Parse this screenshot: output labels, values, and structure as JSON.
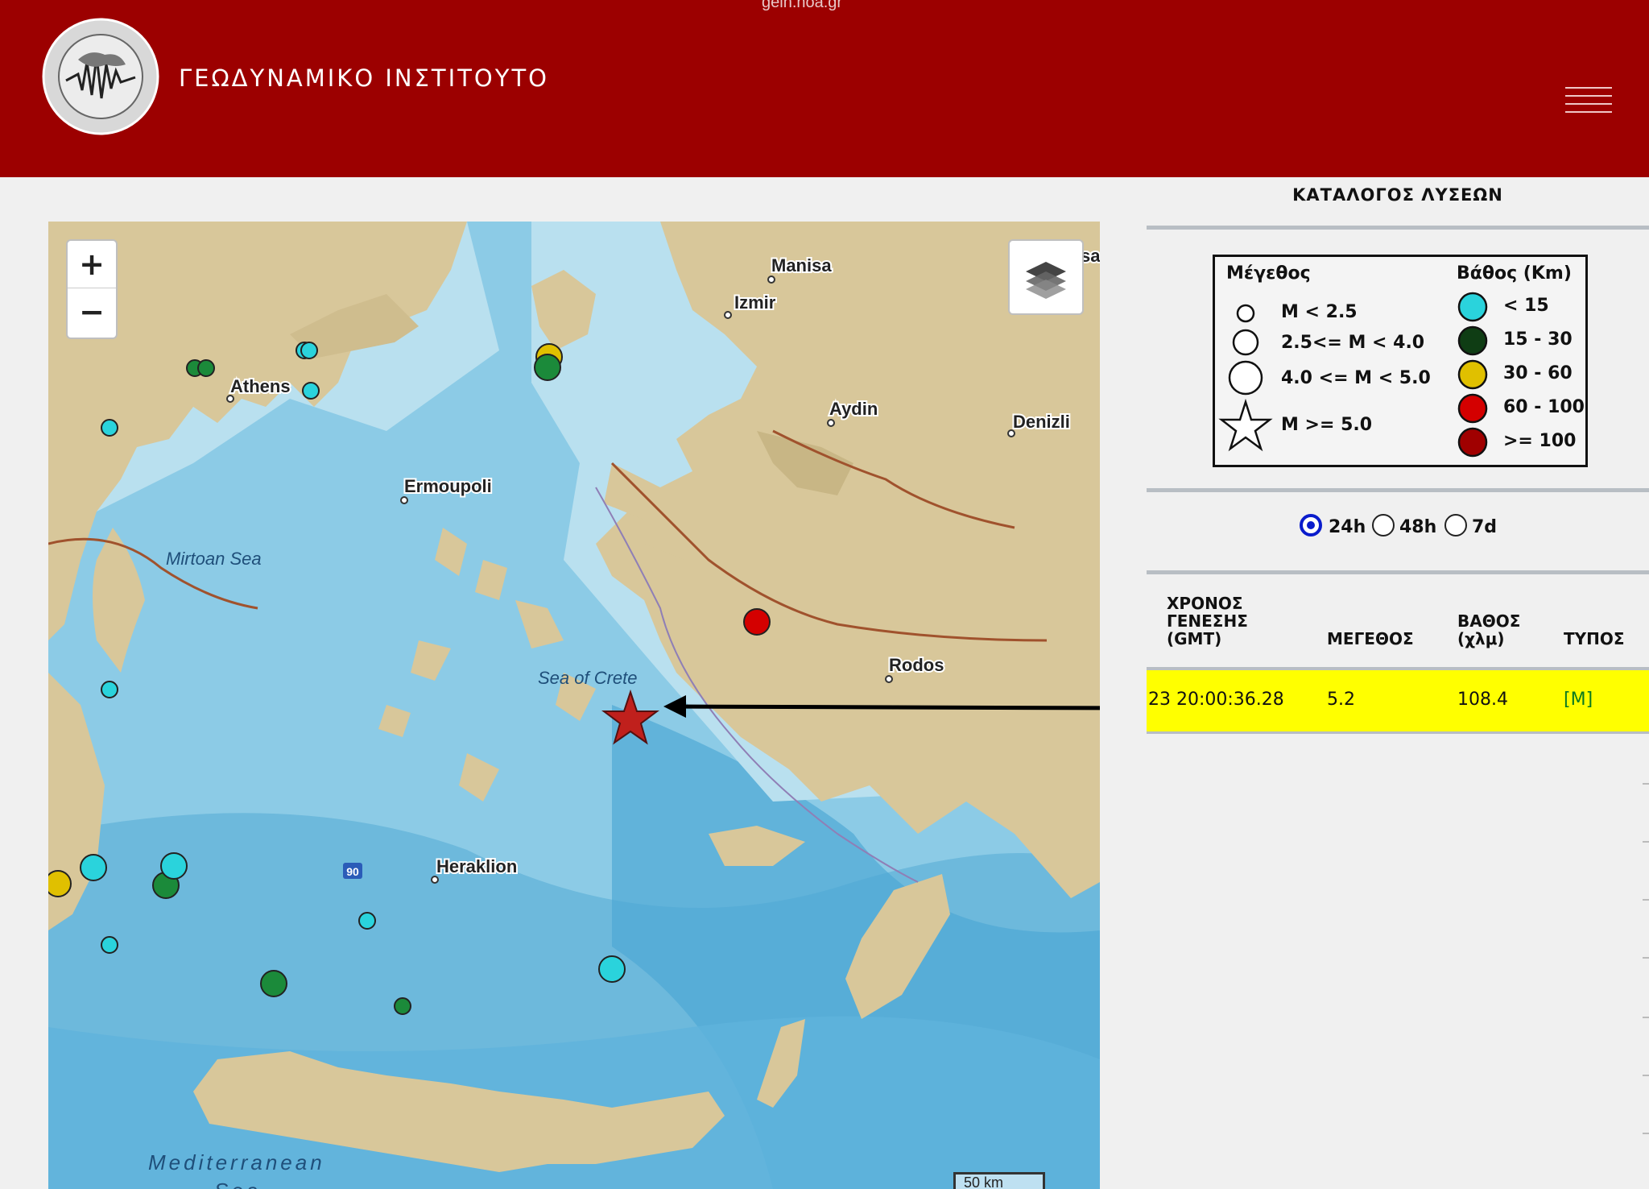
{
  "header": {
    "url": "gein.noa.gr",
    "title": "ΓΕΩΔΥΝΑΜΙΚΟ ΙΝΣΤΙΤΟΥΤΟ"
  },
  "map": {
    "zoom_in": "+",
    "zoom_out": "−",
    "scale": "50 km",
    "route_shield": "90",
    "labels": {
      "manisa": "Manisa",
      "izmir": "Izmir",
      "aydin": "Aydin",
      "denizli": "Denizli",
      "athens": "Athens",
      "ermoupoli": "Ermoupoli",
      "mirtoan": "Mirtoan Sea",
      "crete_sea": "Sea of Crete",
      "rodos": "Rodos",
      "heraklion": "Heraklion",
      "mediterranean": "Mediterranean",
      "sea": "Sea",
      "edge_fragment": "sal"
    }
  },
  "panel": {
    "title": "ΚΑΤΑΛΟΓΟΣ ΛΥΣΕΩΝ",
    "legend": {
      "magnitude_header": "Μέγεθος",
      "depth_header": "Βάθος (Km)",
      "magnitude_rows": [
        "M < 2.5",
        "2.5<= M < 4.0",
        "4.0 <= M < 5.0",
        "M >= 5.0"
      ],
      "depth_rows": [
        "< 15",
        "15 - 30",
        "30 - 60",
        "60 - 100",
        ">= 100"
      ],
      "depth_colors": [
        "#2ad3dc",
        "#0f3d14",
        "#e0c000",
        "#d40000",
        "#a00000"
      ]
    },
    "time_options": [
      "24h",
      "48h",
      "7d"
    ],
    "selected_time": "24h",
    "table": {
      "headers": {
        "time": [
          "ΧΡΟΝΟΣ",
          "ΓΕΝΕΣΗΣ",
          "(GMT)"
        ],
        "magnitude": "ΜΕΓΕΘΟΣ",
        "depth": [
          "ΒΑΘΟΣ",
          "(χλμ)"
        ],
        "type": "ΤΥΠΟΣ"
      },
      "rows": [
        {
          "time": "23 20:00:36.28",
          "magnitude": "5.2",
          "depth": "108.4",
          "type": "[M]"
        }
      ]
    }
  }
}
